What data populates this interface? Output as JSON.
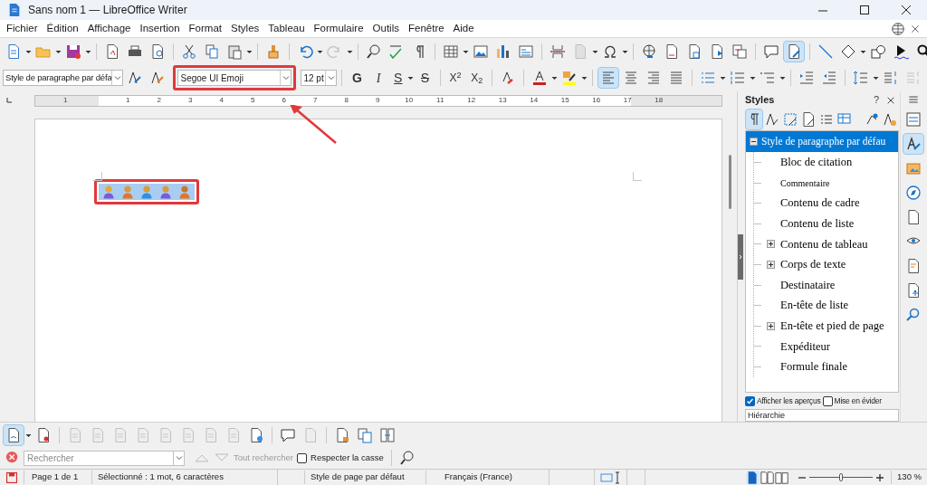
{
  "window": {
    "title": "Sans nom 1 — LibreOffice Writer"
  },
  "menu": [
    "Fichier",
    "Édition",
    "Affichage",
    "Insertion",
    "Format",
    "Styles",
    "Tableau",
    "Formulaire",
    "Outils",
    "Fenêtre",
    "Aide"
  ],
  "standard_toolbar": {
    "edit_document_selected": true
  },
  "formatting": {
    "paragraph_style": "Style de paragraphe par défa",
    "font_name": "Segoe UI Emoji",
    "font_size": "12 pt",
    "bold": "G",
    "italic": "I",
    "underline": "S",
    "strikethrough": "S",
    "superscript": "X$^{2}$",
    "subscript": "X$_{2}$",
    "alignment": [
      {
        "kind": "left",
        "selected": true
      },
      {
        "kind": "center",
        "selected": false
      },
      {
        "kind": "right",
        "selected": false
      },
      {
        "kind": "justify",
        "selected": false
      }
    ]
  },
  "ruler": {
    "labels": [
      "1",
      "1",
      "2",
      "3",
      "4",
      "5",
      "6",
      "7",
      "8",
      "9",
      "10",
      "11",
      "12",
      "13",
      "14",
      "15",
      "16",
      "17",
      "18"
    ]
  },
  "sidebar": {
    "title": "Styles",
    "help": "?",
    "families": [
      {
        "kind": "paragraph",
        "selected": true
      },
      {
        "kind": "character",
        "selected": false
      },
      {
        "kind": "frame",
        "selected": false
      },
      {
        "kind": "page",
        "selected": false
      },
      {
        "kind": "list",
        "selected": false
      },
      {
        "kind": "table",
        "selected": false
      }
    ],
    "styles": [
      {
        "label": "Style de paragraphe par défau",
        "selected": true,
        "kind": "expanded",
        "small_preview": false,
        "children": [
          {
            "label": "Bloc de citation",
            "selected": false,
            "kind": "leaf",
            "small_preview": false
          },
          {
            "label": "Commentaire",
            "selected": false,
            "kind": "leaf",
            "small_preview": true
          },
          {
            "label": "Contenu de cadre",
            "selected": false,
            "kind": "leaf",
            "small_preview": false
          },
          {
            "label": "Contenu de liste",
            "selected": false,
            "kind": "leaf",
            "small_preview": false
          },
          {
            "label": "Contenu de tableau",
            "selected": false,
            "kind": "collapsed",
            "small_preview": false
          },
          {
            "label": "Corps de texte",
            "selected": false,
            "kind": "collapsed",
            "small_preview": false
          },
          {
            "label": "Destinataire",
            "selected": false,
            "kind": "leaf",
            "small_preview": false
          },
          {
            "label": "En-tête de liste",
            "selected": false,
            "kind": "leaf",
            "small_preview": false
          },
          {
            "label": "En-tête et pied de page",
            "selected": false,
            "kind": "collapsed",
            "small_preview": false
          },
          {
            "label": "Expéditeur",
            "selected": false,
            "kind": "leaf",
            "small_preview": false
          },
          {
            "label": "Formule finale",
            "selected": false,
            "kind": "leaf",
            "small_preview": false
          }
        ]
      }
    ],
    "show_previews": {
      "label": "Afficher les aperçus",
      "checked": true
    },
    "highlight_used": {
      "label": "Mise en évider",
      "checked": false
    },
    "filter": "Hiérarchie",
    "tabs": [
      {
        "kind": "properties",
        "selected": false
      },
      {
        "kind": "styles",
        "selected": true
      },
      {
        "kind": "gallery",
        "selected": false
      },
      {
        "kind": "navigator",
        "selected": false
      },
      {
        "kind": "page",
        "selected": false
      },
      {
        "kind": "inspector",
        "selected": false
      },
      {
        "kind": "changes",
        "selected": false
      },
      {
        "kind": "accessibility",
        "selected": false
      },
      {
        "kind": "find",
        "selected": false
      }
    ]
  },
  "track_changes_toolbar": {
    "show_changes_selected": true
  },
  "find_bar": {
    "placeholder": "Rechercher",
    "find_all": "Tout rechercher",
    "match_case": {
      "label": "Respecter la casse",
      "checked": false
    }
  },
  "status_bar": {
    "page": "Page 1 de 1",
    "selection": "Sélectionné : 1 mot, 6 caractères",
    "page_style": "Style de page par défaut",
    "language": "Français (France)",
    "view_modes": [
      {
        "kind": "single",
        "selected": true
      },
      {
        "kind": "multi",
        "selected": false
      },
      {
        "kind": "book",
        "selected": false
      }
    ],
    "zoom": {
      "level": 0.5,
      "reading": "130 %"
    }
  }
}
